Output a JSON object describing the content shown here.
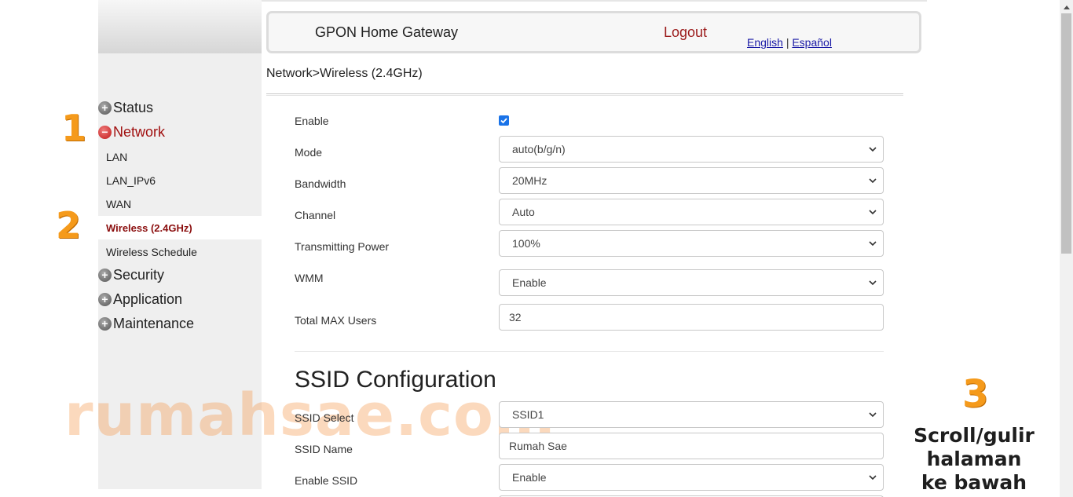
{
  "header": {
    "title": "GPON Home Gateway",
    "logout": "Logout",
    "lang_english": "English",
    "lang_separator": "|",
    "lang_spanish": "Español"
  },
  "sidebar": {
    "status": "Status",
    "network": "Network",
    "network_items": [
      "LAN",
      "LAN_IPv6",
      "WAN",
      "Wireless (2.4GHz)",
      "Wireless Schedule"
    ],
    "security": "Security",
    "application": "Application",
    "maintenance": "Maintenance"
  },
  "breadcrumb": "Network>Wireless (2.4GHz)",
  "form": {
    "enable": {
      "label": "Enable",
      "checked": true
    },
    "mode": {
      "label": "Mode",
      "value": "auto(b/g/n)"
    },
    "bandwidth": {
      "label": "Bandwidth",
      "value": "20MHz"
    },
    "channel": {
      "label": "Channel",
      "value": "Auto"
    },
    "tx_power": {
      "label": "Transmitting Power",
      "value": "100%"
    },
    "wmm": {
      "label": "WMM",
      "value": "Enable"
    },
    "max_users": {
      "label": "Total MAX Users",
      "value": "32"
    }
  },
  "ssid": {
    "title": "SSID Configuration",
    "select": {
      "label": "SSID Select",
      "value": "SSID1"
    },
    "name": {
      "label": "SSID Name",
      "value": "Rumah Sae"
    },
    "enable_ssid": {
      "label": "Enable SSID",
      "value": "Enable"
    }
  },
  "annotations": {
    "step1": "1",
    "step2": "2",
    "step3": "3",
    "scroll_line1": "Scroll/gulir",
    "scroll_line2": "halaman",
    "scroll_line3": "ke bawah",
    "watermark": "rumahsae.com"
  },
  "colors": {
    "accent_red": "#9b1b1b",
    "link_blue": "#1a1aa6",
    "annotation_orange": "#f59a1b",
    "checkbox_blue": "#1a73e8"
  }
}
